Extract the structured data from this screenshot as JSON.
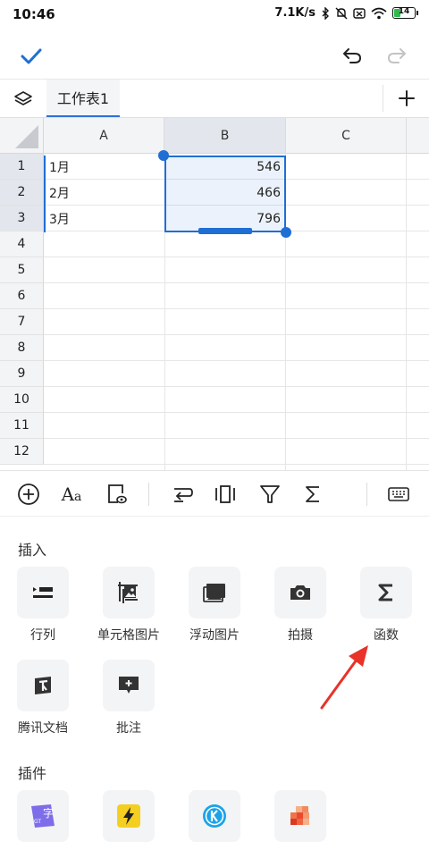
{
  "status_bar": {
    "time": "10:46",
    "network_speed": "7.1K/s",
    "battery": "14"
  },
  "colors": {
    "accent": "#1f6ed4",
    "arrow": "#e8322a"
  },
  "tabs": {
    "active": "工作表1"
  },
  "sheet": {
    "columns": [
      "A",
      "B",
      "C"
    ],
    "rows": [
      "1",
      "2",
      "3",
      "4",
      "5",
      "6",
      "7",
      "8",
      "9",
      "10",
      "11",
      "12"
    ],
    "cells": [
      {
        "a": "1月",
        "b": "546"
      },
      {
        "a": "2月",
        "b": "466"
      },
      {
        "a": "3月",
        "b": "796"
      }
    ]
  },
  "toolbar": {
    "icons": [
      "add-circle-icon",
      "font-format-icon",
      "cell-preview-icon",
      "wrap-text-icon",
      "freeze-columns-icon",
      "filter-icon",
      "sum-icon",
      "keyboard-icon"
    ]
  },
  "panel": {
    "insert_title": "插入",
    "insert_items": [
      {
        "label": "行列",
        "icon": "row-col-icon"
      },
      {
        "label": "单元格图片",
        "icon": "cell-image-icon"
      },
      {
        "label": "浮动图片",
        "icon": "floating-image-icon"
      },
      {
        "label": "拍摄",
        "icon": "camera-icon"
      },
      {
        "label": "函数",
        "icon": "function-sigma-icon"
      },
      {
        "label": "腾讯文档",
        "icon": "tencent-docs-icon"
      },
      {
        "label": "批注",
        "icon": "comment-icon"
      }
    ],
    "plugins_title": "插件",
    "plugin_icons": [
      "plugin-translate-icon",
      "plugin-flash-icon",
      "plugin-k-icon",
      "plugin-mosaic-icon"
    ]
  }
}
